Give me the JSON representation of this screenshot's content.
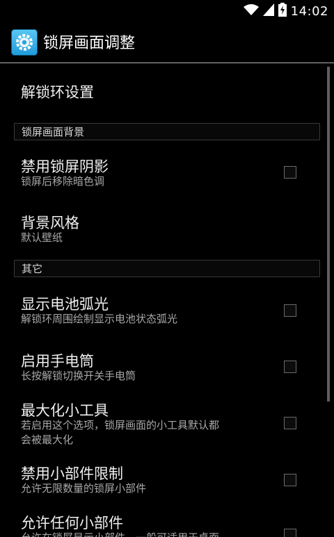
{
  "status_bar": {
    "time": "14:02",
    "icons": [
      "wifi-icon",
      "signal-icon",
      "battery-charging-icon"
    ]
  },
  "action_bar": {
    "title": "锁屏画面调整",
    "icon": "settings-gear-icon"
  },
  "items": [
    {
      "kind": "item",
      "title": "解锁环设置"
    },
    {
      "kind": "section",
      "title": "锁屏画面背景"
    },
    {
      "kind": "item",
      "title": "禁用锁屏阴影",
      "summary": "锁屏后移除暗色调",
      "checked": false
    },
    {
      "kind": "item",
      "title": "背景风格",
      "summary": "默认壁纸"
    },
    {
      "kind": "section",
      "title": "其它"
    },
    {
      "kind": "item",
      "title": "显示电池弧光",
      "summary": "解锁环周围绘制显示电池状态弧光",
      "checked": false
    },
    {
      "kind": "item",
      "title": "启用手电筒",
      "summary": "长按解锁切换开关手电筒",
      "checked": false
    },
    {
      "kind": "item",
      "title": "最大化小工具",
      "summary_lines": [
        "若启用这个选项，锁屏画面的小工具默认都",
        "会被最大化"
      ],
      "checked": false
    },
    {
      "kind": "item",
      "title": "禁用小部件限制",
      "summary": "允许无限数量的锁屏小部件",
      "checked": false
    },
    {
      "kind": "item",
      "title": "允许任何小部件",
      "summary": "允许在锁屏显示小部件，一般可适用于桌面",
      "checked": false
    }
  ]
}
